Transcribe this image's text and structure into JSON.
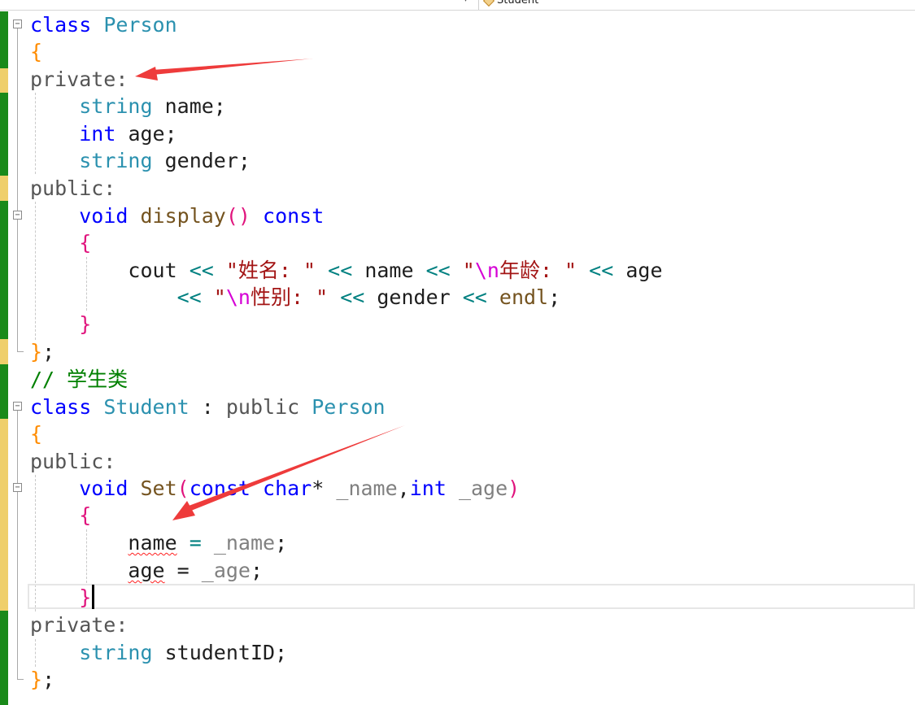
{
  "navbar": {
    "member_label": "Student"
  },
  "code": {
    "line1": {
      "kw": "class",
      "name": "Person"
    },
    "line2": {
      "brace": "{"
    },
    "line3": {
      "access": "private:"
    },
    "line4": {
      "type": "string",
      "rest": "name;"
    },
    "line5": {
      "kw": "int",
      "rest": "age;"
    },
    "line6": {
      "type": "string",
      "rest": "gender;"
    },
    "line7": {
      "access": "public:"
    },
    "line8": {
      "kw": "void",
      "fn": "display",
      "paren": "()",
      "kw2": "const"
    },
    "line9": {
      "brace": "{"
    },
    "line10": {
      "a": "cout",
      "op1": "<<",
      "s1a": "\"姓名: ",
      "s1b": "\"",
      "op2": "<<",
      "b": "name",
      "op3": "<<",
      "s2a": "\"",
      "esc1": "\\n",
      "s2b": "年龄: \"",
      "op4": "<<",
      "c": "age"
    },
    "line11": {
      "op1": "<<",
      "s1a": "\"",
      "esc1": "\\n",
      "s1b": "性别: \"",
      "op2": "<<",
      "a": "gender",
      "op3": "<<",
      "b": "endl",
      "semi": ";"
    },
    "line12": {
      "brace": "}"
    },
    "line13": {
      "brace": "}",
      "semi": ";"
    },
    "line14": {
      "comment": "// 学生类"
    },
    "line15": {
      "kw": "class",
      "name": "Student",
      "colon": ":",
      "access": "public",
      "base": "Person"
    },
    "line16": {
      "brace": "{"
    },
    "line17": {
      "access": "public:"
    },
    "line18": {
      "kw": "void",
      "fn": "Set",
      "open": "(",
      "kw2": "const",
      "kw3": "char",
      "star": "*",
      "p1": "_name",
      "comma": ",",
      "kw4": "int",
      "p2": "_age",
      "close": ")"
    },
    "line19": {
      "brace": "{"
    },
    "line20": {
      "a": "name",
      "op": "=",
      "b": "_name",
      "semi": ";"
    },
    "line21": {
      "a": "age",
      "op": "=",
      "b": "_age",
      "semi": ";"
    },
    "line22": {
      "brace": "}"
    },
    "line23": {
      "access": "private:"
    },
    "line24": {
      "type": "string",
      "rest": "studentID;"
    },
    "line25": {
      "brace": "}",
      "semi": ";"
    }
  },
  "colors": {
    "keyword": "#0000ff",
    "type": "#2b91af",
    "string": "#a31515",
    "comment": "#008000",
    "arrow": "#ee3b3b",
    "margin_saved": "#1a8a1a",
    "margin_unsaved": "#efcf6b"
  }
}
